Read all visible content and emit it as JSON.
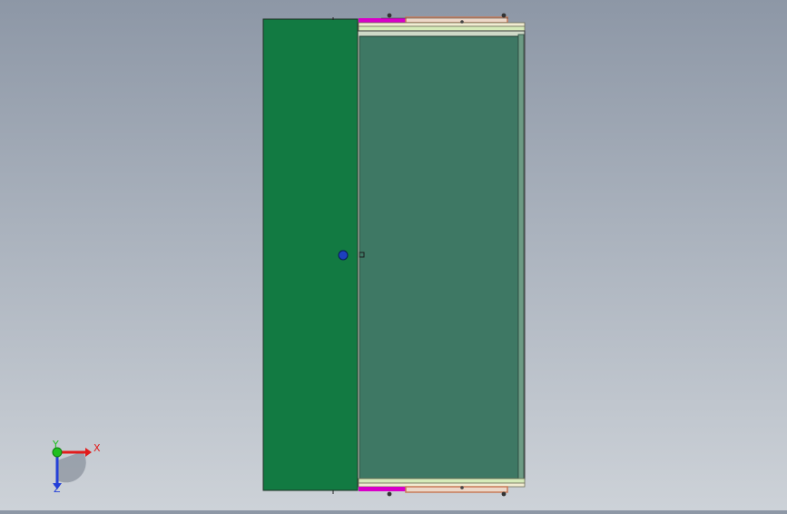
{
  "model": {
    "left_panel_color": "#127a42",
    "right_panel_color": "#3e7864",
    "frame_color": "#b9b98f",
    "rail_magenta": "#d800c8",
    "rail_copper": "#c87a58",
    "origin_marker_color": "#1d3fbf"
  },
  "triad": {
    "x_label": "X",
    "y_label": "Y",
    "z_label": "Z",
    "x_color": "#e21c1c",
    "y_color": "#1fbf1f",
    "z_color": "#2440d8"
  },
  "icons": {
    "origin": "origin-point-icon",
    "triad": "coordinate-triad-icon"
  }
}
